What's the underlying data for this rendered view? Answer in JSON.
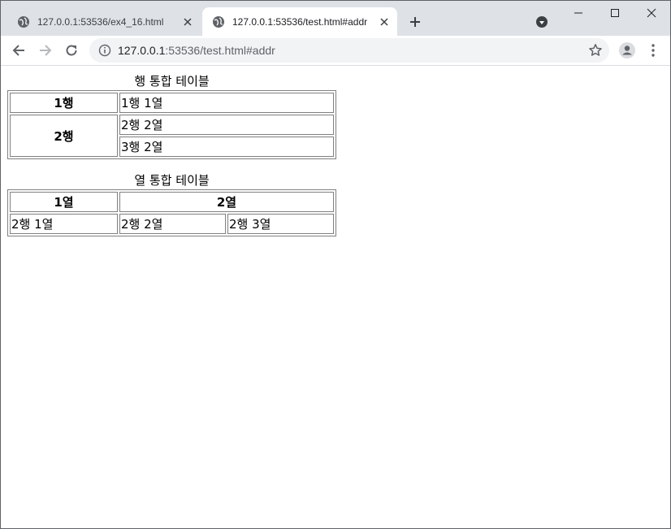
{
  "browser": {
    "tabs": [
      {
        "title": "127.0.0.1:53536/ex4_16.html",
        "active": false
      },
      {
        "title": "127.0.0.1:53536/test.html#addr",
        "active": true
      }
    ],
    "address": {
      "host": "127.0.0.1",
      "rest": ":53536/test.html#addr"
    }
  },
  "page": {
    "table1": {
      "caption": "행 통합 테이블",
      "r1": {
        "h": "1행",
        "c": "1행 1열"
      },
      "r2": {
        "h": "2행",
        "c": "2행 2열"
      },
      "r3": {
        "c": "3행 2열"
      }
    },
    "table2": {
      "caption": "열 통합 테이블",
      "h1": "1열",
      "h2": "2열",
      "row": [
        "2행 1열",
        "2행 2열",
        "2행 3열"
      ]
    }
  },
  "icons": [
    "globe-icon",
    "close-icon",
    "plus-icon",
    "tab-search-icon",
    "minimize-icon",
    "maximize-icon",
    "window-close-icon",
    "back-icon",
    "forward-icon",
    "reload-icon",
    "info-icon",
    "star-icon",
    "profile-icon",
    "more-icon"
  ]
}
